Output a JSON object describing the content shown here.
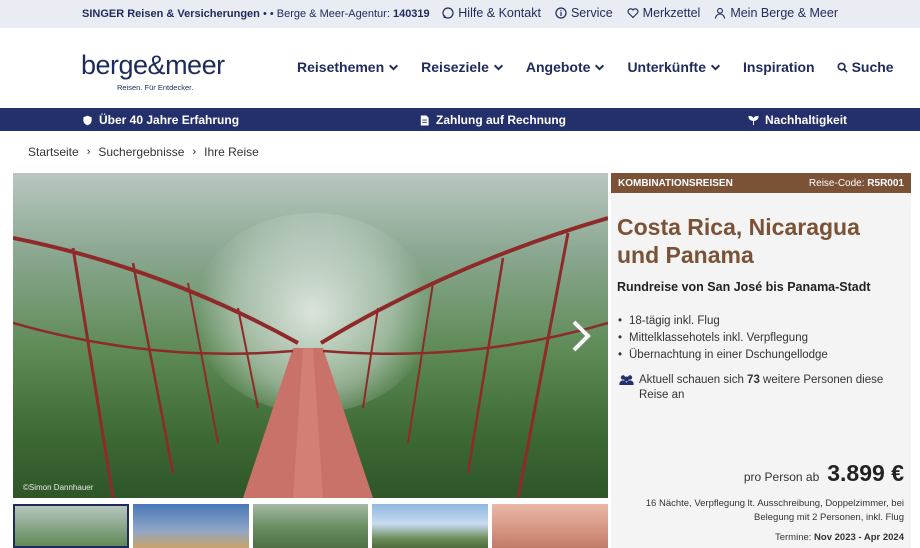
{
  "topbar": {
    "agency": "SINGER Reisen & Versicherungen",
    "agent_prefix": "Berge & Meer-Agentur:",
    "agent_id": "140319",
    "links": [
      "Hilfe & Kontakt",
      "Service",
      "Merkzettel",
      "Mein Berge & Meer"
    ]
  },
  "header": {
    "logo_word": "berge&meer",
    "logo_tagline": "Reisen. Für Entdecker.",
    "nav": [
      "Reisethemen",
      "Reiseziele",
      "Angebote",
      "Unterkünfte",
      "Inspiration",
      "Suche"
    ]
  },
  "usp": [
    "Über 40 Jahre Erfahrung",
    "Zahlung auf Rechnung",
    "Nachhaltigkeit"
  ],
  "breadcrumb": [
    "Startseite",
    "Suchergebnisse",
    "Ihre Reise"
  ],
  "gallery": {
    "credit": "©Simon Dannhauer"
  },
  "offer": {
    "category": "KOMBINATIONSREISEN",
    "code_label": "Reise-Code:",
    "code": "R5R001",
    "title_line1": "Costa Rica, Nicaragua",
    "title_line2": "und Panama",
    "subtitle": "Rundreise von San José bis Panama-Stadt",
    "features": [
      "18-tägig inkl. Flug",
      "Mittelklassehotels inkl. Verpflegung",
      "Übernachtung in einer Dschungellodge"
    ],
    "watch_pre": "Aktuell schauen sich",
    "watch_count": "73",
    "watch_post": "weitere Personen diese Reise an",
    "price_label": "pro Person ab",
    "price": "3.899 €",
    "terms": "16 Nächte, Verpflegung lt. Ausschreibung, Doppelzimmer, bei Belegung mit 2 Personen, inkl. Flug",
    "dates_label": "Termine:",
    "dates": "Nov 2023 - Apr 2024"
  },
  "colors": {
    "navy": "#1e2b5c",
    "brown": "#7b5236",
    "usp_bg": "#24306b"
  }
}
